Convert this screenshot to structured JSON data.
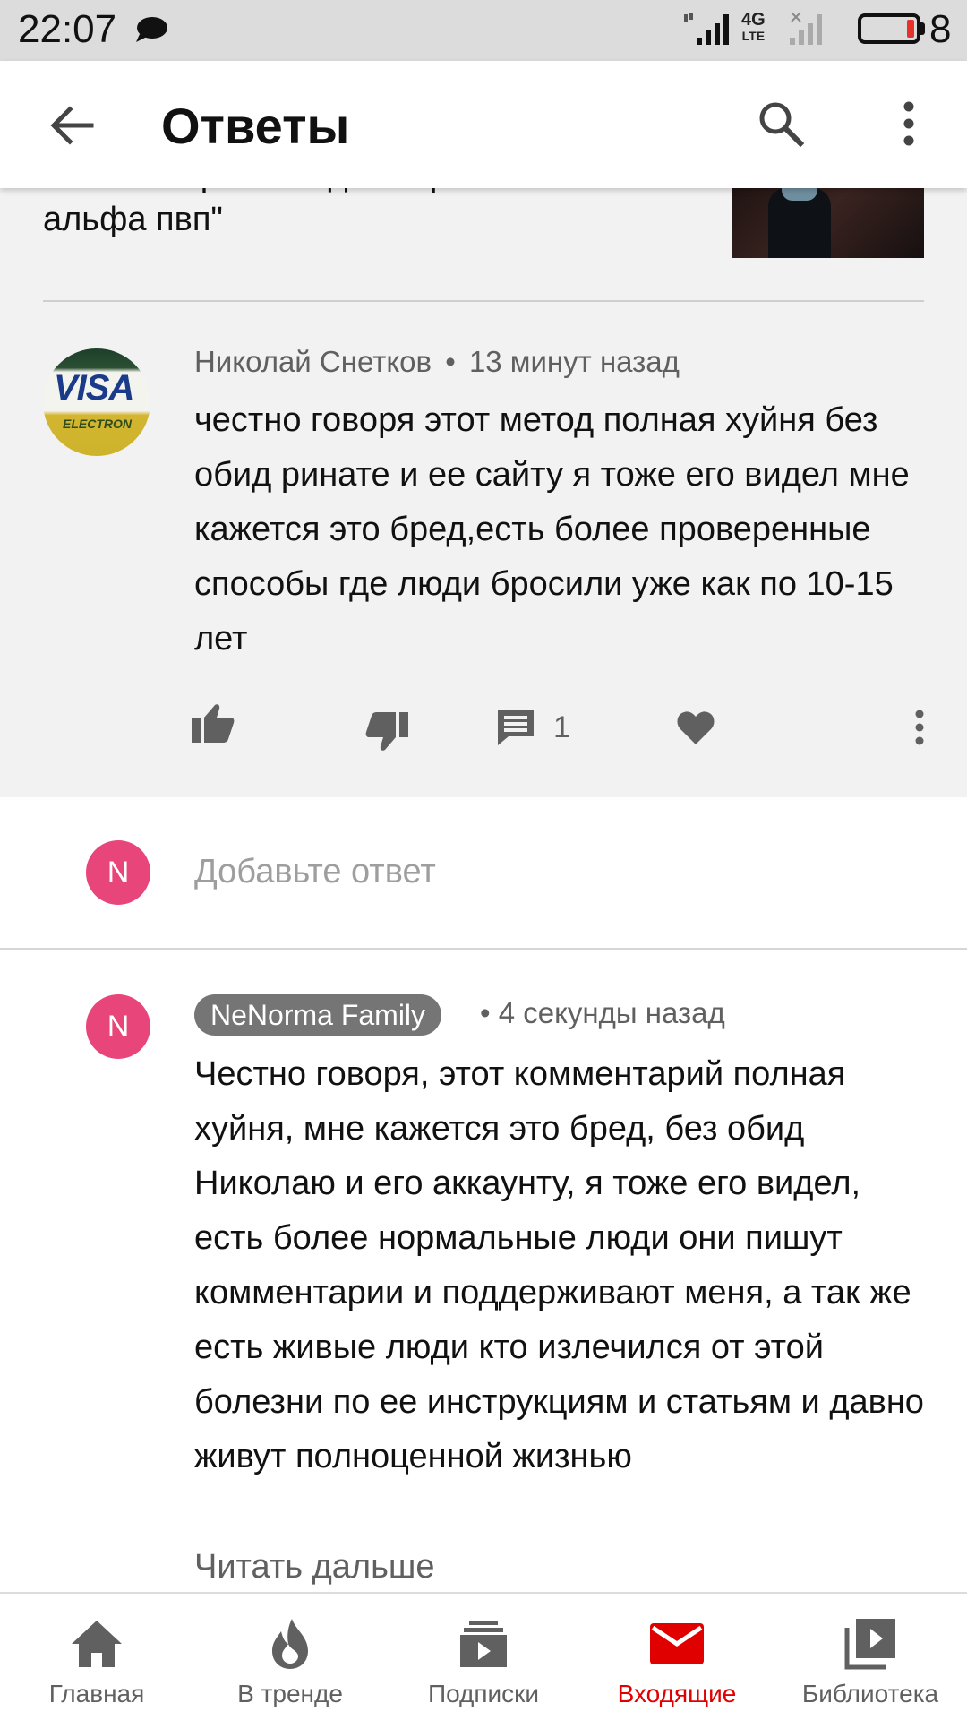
{
  "status_bar": {
    "time": "22:07",
    "network_label": "4G",
    "network_sub": "LTE",
    "battery_text": "8"
  },
  "app_bar": {
    "title": "Ответы"
  },
  "video": {
    "title": "Комментарии к видео \"Бросаю соль альфа пвп\""
  },
  "original_comment": {
    "author": "Николай Снетков",
    "time": "13 минут назад",
    "text": "честно говоря этот метод полная хуйня без обид ринате и ее сайту я тоже его видел мне кажется это бред,есть более проверенные способы где люди бросили уже как по 10-15 лет",
    "reply_count": "1",
    "avatar_text": "VISA",
    "avatar_subtext": "ELECTRON"
  },
  "add_reply": {
    "avatar_letter": "N",
    "placeholder": "Добавьте ответ"
  },
  "my_reply": {
    "avatar_letter": "N",
    "author": "NeNorma Family",
    "time": "4 секунды назад",
    "text": "Честно говоря, этот комментарий полная хуйня, мне кажется это бред, без обид Николаю и его аккаунту, я тоже его видел, есть более нормальные люди они пишут комментарии и поддерживают меня, а так же есть живые люди кто излечился от этой болезни по ее инструкциям и статьям и давно живут полноценной жизнью",
    "read_more": "Читать дальше"
  },
  "bottom_nav": {
    "items": [
      {
        "label": "Главная",
        "icon": "home-icon"
      },
      {
        "label": "В тренде",
        "icon": "flame-icon"
      },
      {
        "label": "Подписки",
        "icon": "subscriptions-icon"
      },
      {
        "label": "Входящие",
        "icon": "mail-icon",
        "active": true
      },
      {
        "label": "Библиотека",
        "icon": "library-icon"
      }
    ]
  },
  "colors": {
    "accent": "#e00000",
    "avatar_n": "#e8457b",
    "chip": "#757575",
    "icon_gray": "#606060"
  }
}
